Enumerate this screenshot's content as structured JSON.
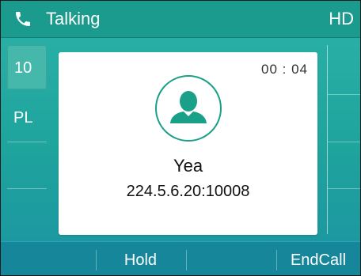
{
  "status_bar": {
    "call_state": "Talking",
    "quality_badge": "HD",
    "icon": "phone-handset-icon"
  },
  "line_keys": [
    {
      "label": "10",
      "active": true
    },
    {
      "label": "PL",
      "active": false
    }
  ],
  "call_card": {
    "duration": "00 : 04",
    "caller_name": "Yea",
    "caller_number": "224.5.6.20:10008",
    "avatar_icon": "contact-avatar-icon"
  },
  "softkeys": [
    {
      "label": ""
    },
    {
      "label": "Hold"
    },
    {
      "label": ""
    },
    {
      "label": "EndCall"
    }
  ],
  "colors": {
    "status_bar": "#1b9a8e",
    "screen_background": "#1fa39d",
    "softkey_bar": "#16879a",
    "avatar_accent": "#1aa088"
  }
}
